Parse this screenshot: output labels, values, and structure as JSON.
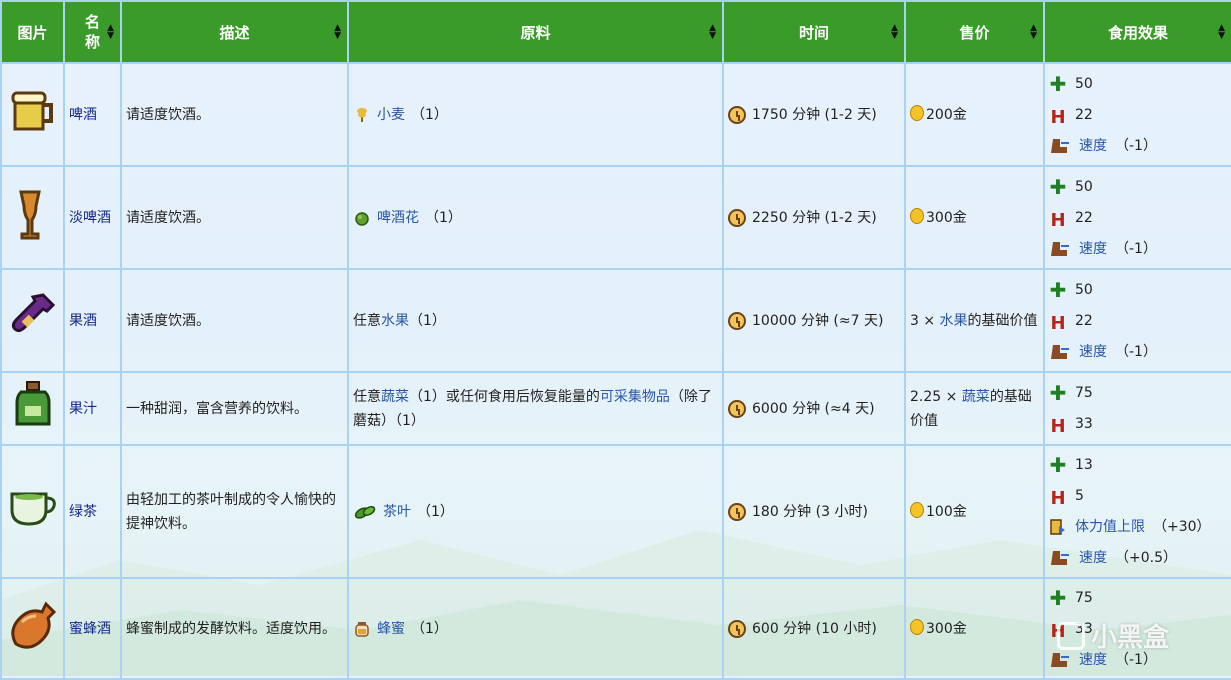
{
  "headers": {
    "image": "图片",
    "name": "名称",
    "desc": "描述",
    "ingredients": "原料",
    "time": "时间",
    "price": "售价",
    "effects": "食用效果"
  },
  "rows": [
    {
      "name": "啤酒",
      "desc": "请适度饮酒。",
      "ingredient": {
        "prefix": "",
        "item": "小麦",
        "qty": "（1）"
      },
      "time": "1750 分钟 (1-2 天)",
      "price": "200金",
      "energy": "50",
      "health": "22",
      "buff": {
        "name": "速度",
        "value": "（-1）"
      }
    },
    {
      "name": "淡啤酒",
      "desc": "请适度饮酒。",
      "ingredient": {
        "prefix": "",
        "item": "啤酒花",
        "qty": "（1）"
      },
      "time": "2250 分钟 (1-2 天)",
      "price": "300金",
      "energy": "50",
      "health": "22",
      "buff": {
        "name": "速度",
        "value": "（-1）"
      }
    },
    {
      "name": "果酒",
      "desc": "请适度饮酒。",
      "ingredient": {
        "prefix": "任意",
        "item": "水果",
        "qty": "（1）"
      },
      "time": "10000 分钟 (≈7 天)",
      "price_text": {
        "a": "3 × ",
        "link": "水果",
        "b": "的基础价值"
      },
      "energy": "50",
      "health": "22",
      "buff": {
        "name": "速度",
        "value": "（-1）"
      }
    },
    {
      "name": "果汁",
      "desc": "一种甜润，富含营养的饮料。",
      "ingredient_text": {
        "a": "任意",
        "link1": "蔬菜",
        "b": "（1）或任何食用后恢复能量的",
        "link2": "可采集物品",
        "c": "（除了蘑菇）（1）"
      },
      "time": "6000 分钟 (≈4 天)",
      "price_text": {
        "a": "2.25 × ",
        "link": "蔬菜",
        "b": "的基础价值"
      },
      "energy": "75",
      "health": "33"
    },
    {
      "name": "绿茶",
      "desc": "由轻加工的茶叶制成的令人愉快的提神饮料。",
      "ingredient": {
        "prefix": "",
        "item": "茶叶",
        "qty": "（1）"
      },
      "time": "180 分钟 (3 小时)",
      "price": "100金",
      "energy": "13",
      "health": "5",
      "buff2": {
        "name": "体力值上限",
        "value": "（+30）"
      },
      "buff": {
        "name": "速度",
        "value": "（+0.5）"
      }
    },
    {
      "name": "蜜蜂酒",
      "desc": "蜂蜜制成的发酵饮料。适度饮用。",
      "ingredient": {
        "prefix": "",
        "item": "蜂蜜",
        "qty": "（1）"
      },
      "time": "600 分钟 (10 小时)",
      "price": "300金",
      "energy": "75",
      "health": "33",
      "buff": {
        "name": "速度",
        "value": "（-1）"
      }
    }
  ],
  "watermark": "小黑盒",
  "colors": {
    "header_bg": "#3a9a2a",
    "border": "#a9d3f2",
    "link": "#2a56a8",
    "name": "#15298a"
  }
}
